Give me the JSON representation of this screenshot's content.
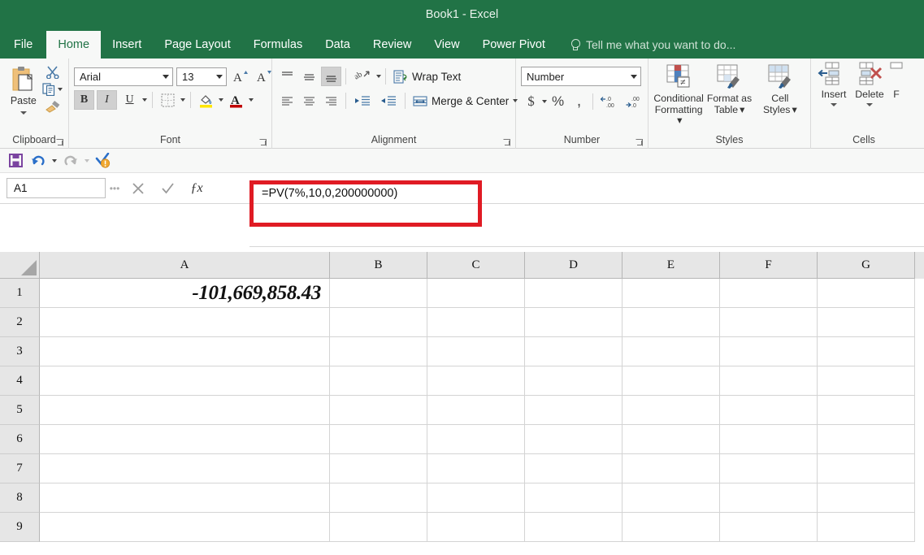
{
  "window": {
    "title": "Book1 - Excel"
  },
  "tabs": [
    {
      "label": "File",
      "active": false
    },
    {
      "label": "Home",
      "active": true
    },
    {
      "label": "Insert",
      "active": false
    },
    {
      "label": "Page Layout",
      "active": false
    },
    {
      "label": "Formulas",
      "active": false
    },
    {
      "label": "Data",
      "active": false
    },
    {
      "label": "Review",
      "active": false
    },
    {
      "label": "View",
      "active": false
    },
    {
      "label": "Power Pivot",
      "active": false
    }
  ],
  "tell_me": {
    "placeholder": "Tell me what you want to do...",
    "icon": "lightbulb-icon"
  },
  "ribbon": {
    "clipboard": {
      "label": "Clipboard",
      "paste_label": "Paste",
      "cut_icon": "scissors-icon",
      "copy_icon": "copy-icon",
      "format_painter_icon": "paintbrush-icon"
    },
    "font": {
      "label": "Font",
      "font_name": "Arial",
      "font_size": "13",
      "grow_label": "A",
      "shrink_label": "A",
      "bold_label": "B",
      "italic_label": "I",
      "underline_label": "U",
      "bold_active": true,
      "italic_active": true,
      "borders_icon": "borders-icon",
      "fill_color_icon": "fill-color-icon",
      "font_color_icon": "font-color-icon",
      "fill_color": "#FFE600",
      "font_color": "#C00000"
    },
    "alignment": {
      "label": "Alignment",
      "wrap_text_label": "Wrap Text",
      "merge_center_label": "Merge & Center",
      "orientation_icon": "orientation-icon",
      "align_bottom_active": true
    },
    "number": {
      "label": "Number",
      "format": "Number",
      "currency_icon": "currency-icon",
      "percent_icon": "percent-icon",
      "comma_icon": "comma-icon",
      "increase_decimal_icon": "increase-decimal-icon",
      "decrease_decimal_icon": "decrease-decimal-icon"
    },
    "styles": {
      "label": "Styles",
      "items": [
        {
          "line1": "Conditional",
          "line2": "Formatting"
        },
        {
          "line1": "Format as",
          "line2": "Table"
        },
        {
          "line1": "Cell",
          "line2": "Styles"
        }
      ]
    },
    "cells": {
      "label": "Cells",
      "items": [
        {
          "label": "Insert"
        },
        {
          "label": "Delete"
        },
        {
          "label": "F"
        }
      ]
    }
  },
  "qat": {
    "save_icon": "save-icon",
    "undo_icon": "undo-icon",
    "redo_icon": "redo-icon",
    "check_warning_icon": "check-warning-icon"
  },
  "formula_bar": {
    "name_box": "A1",
    "cancel_icon": "cancel-icon",
    "enter_icon": "enter-icon",
    "function_icon": "fx-icon",
    "formula": "=PV(7%,10,0,200000000)",
    "highlight_color": "#E01B24"
  },
  "grid": {
    "columns": [
      "A",
      "B",
      "C",
      "D",
      "E",
      "F",
      "G"
    ],
    "rows": [
      "1",
      "2",
      "3",
      "4",
      "5",
      "6",
      "7",
      "8",
      "9"
    ],
    "cells": {
      "A1": "-101,669,858.43"
    }
  }
}
